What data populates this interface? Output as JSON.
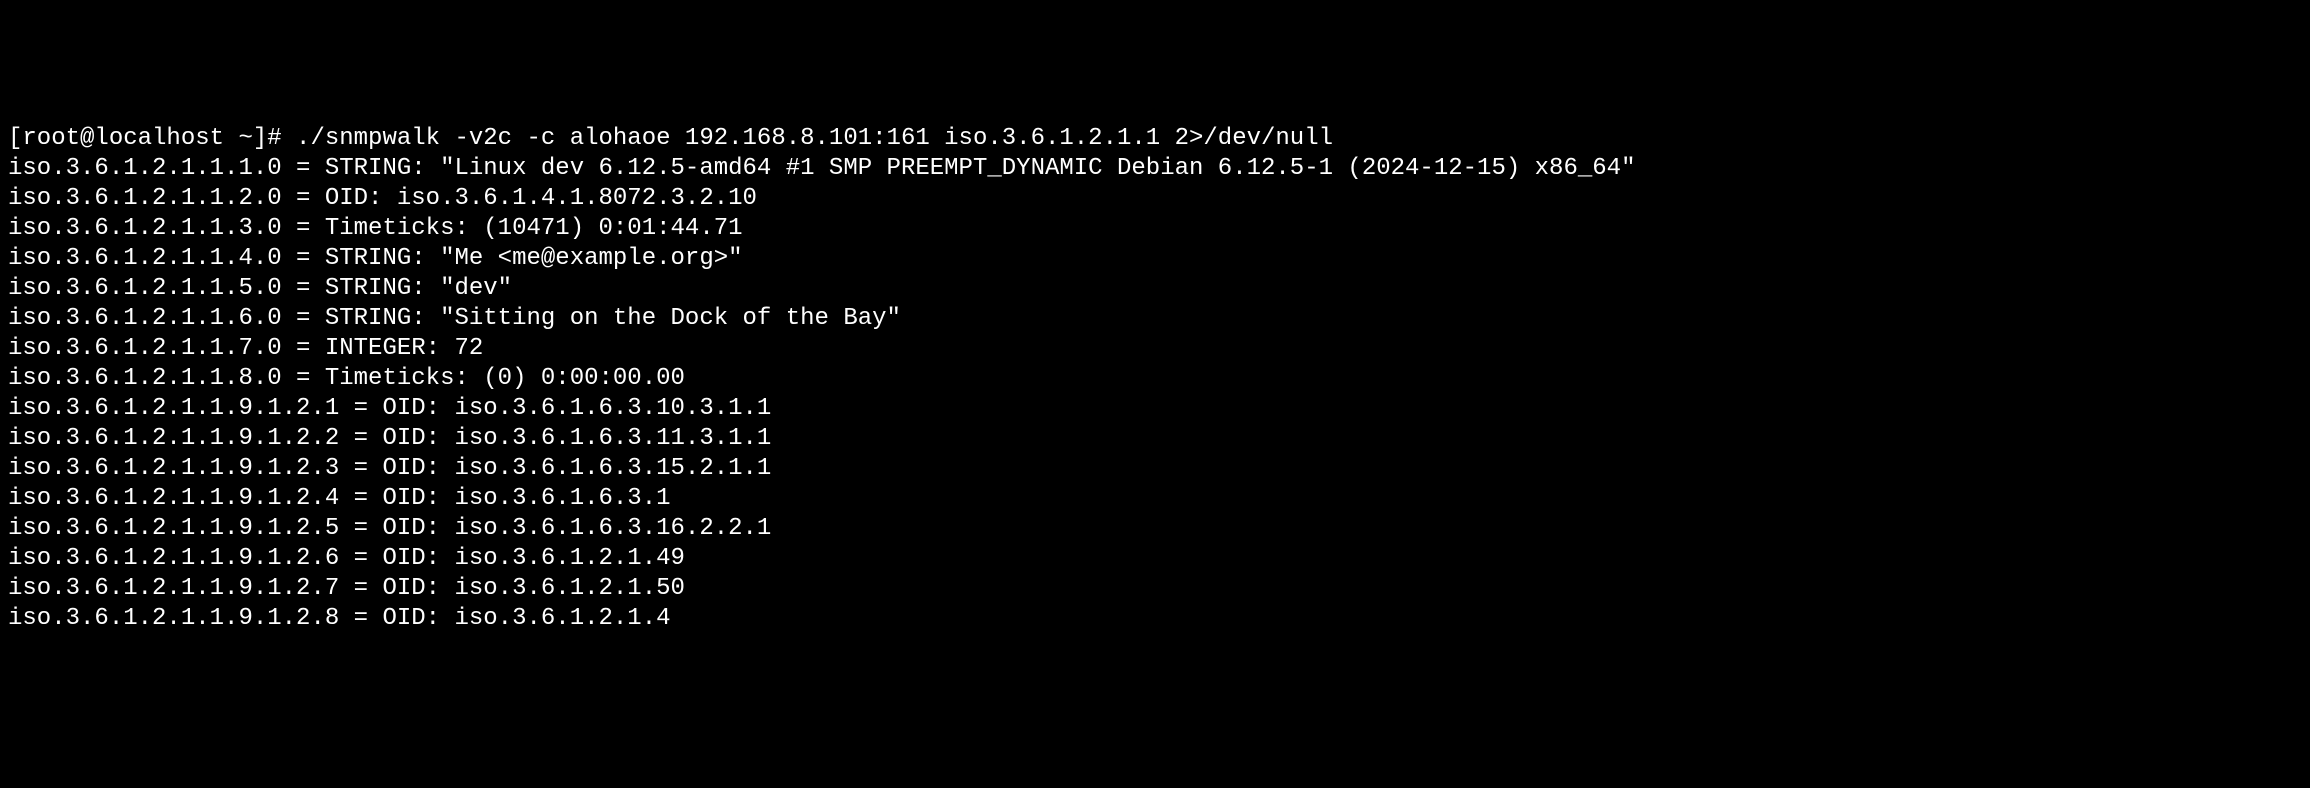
{
  "terminal": {
    "prompt": "[root@localhost ~]# ",
    "command": "./snmpwalk -v2c -c alohaoe 192.168.8.101:161 iso.3.6.1.2.1.1 2>/dev/null",
    "output": [
      "iso.3.6.1.2.1.1.1.0 = STRING: \"Linux dev 6.12.5-amd64 #1 SMP PREEMPT_DYNAMIC Debian 6.12.5-1 (2024-12-15) x86_64\"",
      "iso.3.6.1.2.1.1.2.0 = OID: iso.3.6.1.4.1.8072.3.2.10",
      "iso.3.6.1.2.1.1.3.0 = Timeticks: (10471) 0:01:44.71",
      "iso.3.6.1.2.1.1.4.0 = STRING: \"Me <me@example.org>\"",
      "iso.3.6.1.2.1.1.5.0 = STRING: \"dev\"",
      "iso.3.6.1.2.1.1.6.0 = STRING: \"Sitting on the Dock of the Bay\"",
      "iso.3.6.1.2.1.1.7.0 = INTEGER: 72",
      "iso.3.6.1.2.1.1.8.0 = Timeticks: (0) 0:00:00.00",
      "iso.3.6.1.2.1.1.9.1.2.1 = OID: iso.3.6.1.6.3.10.3.1.1",
      "iso.3.6.1.2.1.1.9.1.2.2 = OID: iso.3.6.1.6.3.11.3.1.1",
      "iso.3.6.1.2.1.1.9.1.2.3 = OID: iso.3.6.1.6.3.15.2.1.1",
      "iso.3.6.1.2.1.1.9.1.2.4 = OID: iso.3.6.1.6.3.1",
      "iso.3.6.1.2.1.1.9.1.2.5 = OID: iso.3.6.1.6.3.16.2.2.1",
      "iso.3.6.1.2.1.1.9.1.2.6 = OID: iso.3.6.1.2.1.49",
      "iso.3.6.1.2.1.1.9.1.2.7 = OID: iso.3.6.1.2.1.50",
      "iso.3.6.1.2.1.1.9.1.2.8 = OID: iso.3.6.1.2.1.4"
    ]
  }
}
